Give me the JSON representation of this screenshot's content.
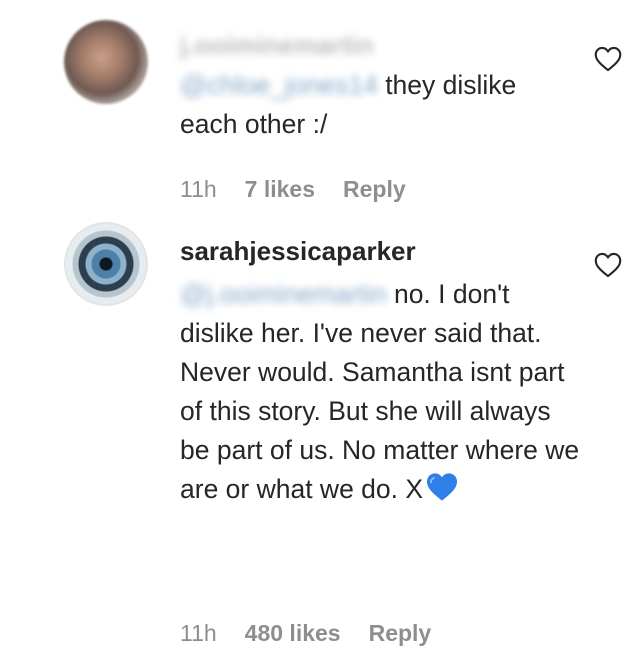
{
  "comments": [
    {
      "username": "j.ooiminemartin",
      "mention": "@chloe_jones14",
      "text_after_mention": " they dislike each other :/",
      "time": "11h",
      "likes": "7 likes",
      "reply": "Reply"
    },
    {
      "username": "sarahjessicaparker",
      "mention": "@j.ooiminemartin",
      "text_after_mention": " no. I don't dislike her. I've never said that. Never would. Samantha isnt part of this story. But she will always be part of us. No matter where we are or what we do. X",
      "emoji": "blue-heart-icon",
      "time": "11h",
      "likes": "480 likes",
      "reply": "Reply"
    }
  ],
  "colors": {
    "text": "#262626",
    "meta": "#8e8e8e",
    "blue_heart": "#2e7fe8"
  }
}
